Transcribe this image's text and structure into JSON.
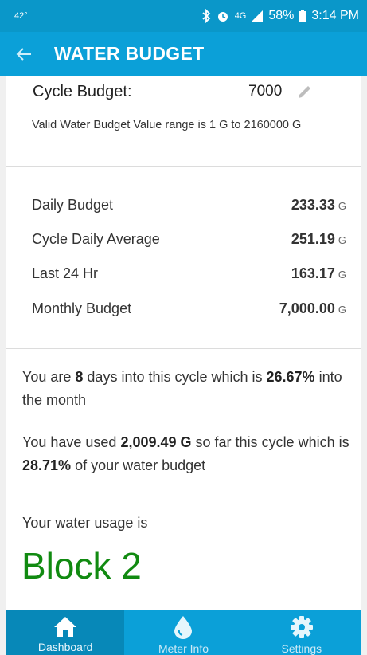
{
  "status": {
    "left_text": "42°",
    "network": "4G",
    "battery": "58%",
    "time": "3:14 PM"
  },
  "app_bar": {
    "title": "WATER BUDGET"
  },
  "budget": {
    "label": "Cycle Budget:",
    "value": "7000",
    "range_note": "Valid Water Budget Value range is 1 G to 2160000 G"
  },
  "stats": [
    {
      "label": "Daily Budget",
      "value": "233.33",
      "unit": "G"
    },
    {
      "label": "Cycle Daily Average",
      "value": "251.19",
      "unit": "G"
    },
    {
      "label": "Last 24 Hr",
      "value": "163.17",
      "unit": "G"
    },
    {
      "label": "Monthly Budget",
      "value": "7,000.00",
      "unit": "G"
    }
  ],
  "cycle_info": {
    "p1_a": "You are ",
    "days": "8",
    "p1_b": " days into this cycle which is ",
    "cycle_pct": "26.67%",
    "p1_c": " into the month",
    "p2_a": "You have used ",
    "used": "2,009.49 G",
    "p2_b": " so far this cycle which is ",
    "used_pct": "28.71%",
    "p2_c": " of your water budget"
  },
  "usage": {
    "label": "Your water usage is",
    "block": "Block 2",
    "block_color": "#118a11"
  },
  "nav": [
    {
      "label": "Dashboard",
      "icon": "home-icon",
      "active": true
    },
    {
      "label": "Meter Info",
      "icon": "water-drop-icon",
      "active": false
    },
    {
      "label": "Settings",
      "icon": "gear-icon",
      "active": false
    }
  ],
  "colors": {
    "status_bar": "#0a97c9",
    "app_bar": "#0ba0d8",
    "nav_active": "#0788b8"
  }
}
